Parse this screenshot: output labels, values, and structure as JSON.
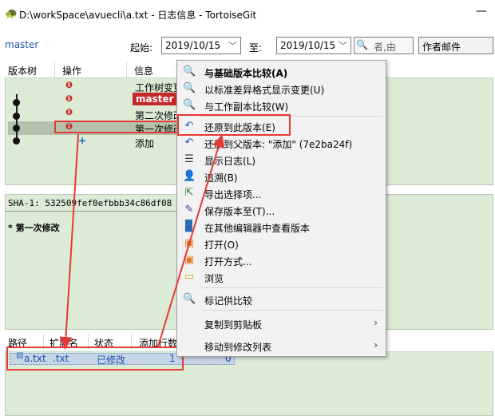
{
  "window": {
    "title": "D:\\workSpace\\avuecli\\a.txt - 日志信息 - TortoiseGit",
    "minimize": "—"
  },
  "toolbar": {
    "branch": "master",
    "from_label": "起始:",
    "from_date": "2019/10/15",
    "to_label": "至:",
    "to_date": "2019/10/15",
    "search_placeholder": "者,由",
    "filter_field": "作者邮件"
  },
  "log": {
    "columns": [
      "版本树",
      "操作",
      "信息"
    ],
    "rows": [
      {
        "message": "工作树变更"
      },
      {
        "tag": "master",
        "message": "第"
      },
      {
        "message": "第二次修改"
      },
      {
        "message": "第一次修改"
      },
      {
        "message": "添加"
      }
    ]
  },
  "details": {
    "sha": "SHA-1: 532509fef0efbbb34c86df08",
    "message": "* 第一次修改"
  },
  "files": {
    "columns": [
      "路径",
      "扩展名",
      "状态",
      "添加行数"
    ],
    "rows": [
      {
        "path": "a.txt",
        "ext": ".txt",
        "status": "已修改",
        "added": "1",
        "deleted": "0"
      }
    ]
  },
  "context_menu": {
    "items": [
      {
        "label": "与基础版本比较(A)",
        "icon": "compare-icon"
      },
      {
        "label": "以标准差异格式显示变更(U)",
        "icon": "diff-icon"
      },
      {
        "label": "与工作副本比较(W)",
        "icon": "compare-working-icon"
      },
      {
        "label": "还原到此版本(E)",
        "icon": "revert-icon"
      },
      {
        "label": "还原到父版本: \"添加\" (7e2ba24f)",
        "icon": "revert-parent-icon"
      },
      {
        "label": "显示日志(L)",
        "icon": "log-icon"
      },
      {
        "label": "追溯(B)",
        "icon": "blame-icon"
      },
      {
        "label": "导出选择项...",
        "icon": "export-icon"
      },
      {
        "label": "保存版本至(T)...",
        "icon": "save-icon"
      },
      {
        "label": "在其他编辑器中查看版本",
        "icon": "editor-icon"
      },
      {
        "label": "打开(O)",
        "icon": "open-icon"
      },
      {
        "label": "打开方式...",
        "icon": "open-with-icon"
      },
      {
        "label": "浏览",
        "icon": "browse-icon"
      },
      {
        "label": "标记供比较",
        "icon": "mark-icon"
      },
      {
        "label": "复制到剪贴板",
        "icon": "clipboard-icon"
      },
      {
        "label": "移动到修改列表",
        "icon": "changelist-icon"
      }
    ]
  },
  "colors": {
    "panel_bg": "#dcebd6",
    "annotation": "#e53935",
    "master_tag": "#c62828",
    "link_blue": "#1e5aa8"
  }
}
